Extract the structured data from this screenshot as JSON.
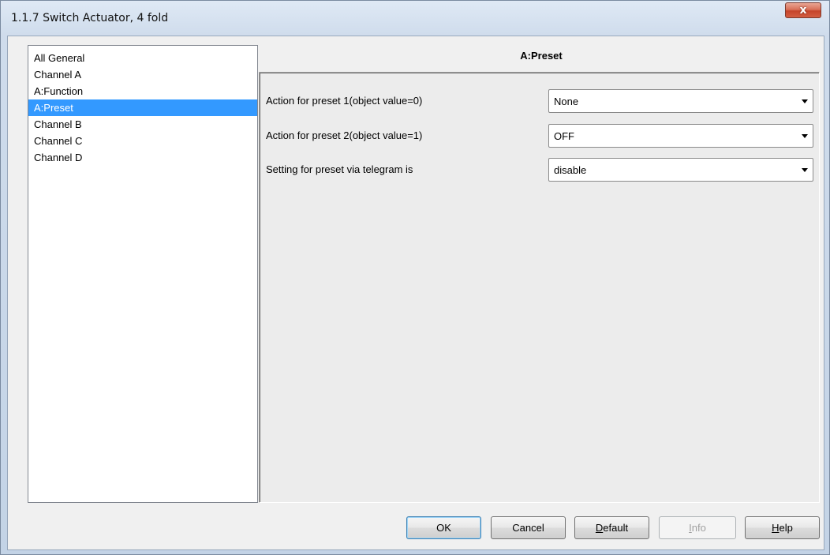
{
  "window": {
    "title": "1.1.7 Switch Actuator, 4 fold",
    "close_glyph": "x"
  },
  "nav": {
    "items": [
      {
        "label": "All General",
        "selected": false
      },
      {
        "label": "Channel A",
        "selected": false
      },
      {
        "label": "A:Function",
        "selected": false
      },
      {
        "label": "A:Preset",
        "selected": true
      },
      {
        "label": "Channel B",
        "selected": false
      },
      {
        "label": "Channel C",
        "selected": false
      },
      {
        "label": "Channel D",
        "selected": false
      }
    ]
  },
  "panel": {
    "title": "A:Preset",
    "params": [
      {
        "label": "Action for preset 1(object value=0)",
        "value": "None"
      },
      {
        "label": "Action for preset 2(object value=1)",
        "value": "OFF"
      },
      {
        "label": "Setting for preset via telegram is",
        "value": "disable"
      }
    ]
  },
  "buttons": {
    "ok": "OK",
    "cancel": "Cancel",
    "default_prefix": "D",
    "default_rest": "efault",
    "info_prefix": "I",
    "info_rest": "nfo",
    "help_prefix": "H",
    "help_rest": "elp"
  },
  "colors": {
    "selection": "#3399ff",
    "close_button": "#c5442a"
  }
}
